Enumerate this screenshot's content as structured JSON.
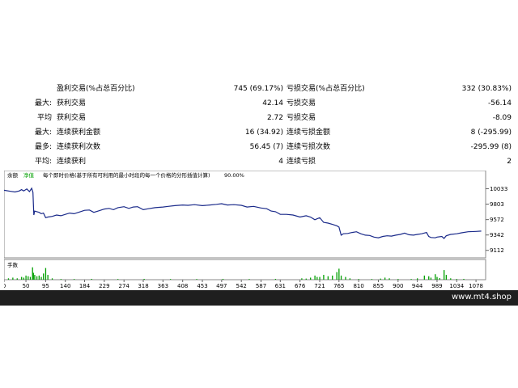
{
  "stats": [
    {
      "prefix": "",
      "label1": "盈利交易(%占总百分比)",
      "value1": "745 (69.17%)",
      "label2": "亏损交易(%占总百分比)",
      "value2": "332 (30.83%)"
    },
    {
      "prefix": "最大:",
      "label1": "获利交易",
      "value1": "42.14",
      "label2": "亏损交易",
      "value2": "-56.14"
    },
    {
      "prefix": "平均",
      "label1": "获利交易",
      "value1": "2.72",
      "label2": "亏损交易",
      "value2": "-8.09"
    },
    {
      "prefix": "最大:",
      "label1": "连续获利金额",
      "value1": "16 (34.92)",
      "label2": "连续亏损金额",
      "value2": "8 (-295.99)"
    },
    {
      "prefix": "最多:",
      "label1": "连续获利次数",
      "value1": "56.45 (7)",
      "label2": "连续亏损次数",
      "value2": "-295.99 (8)"
    },
    {
      "prefix": "平均:",
      "label1": "连续获利",
      "value1": "4",
      "label2": "连续亏损",
      "value2": "2"
    }
  ],
  "chart_header": {
    "tab_balance": "余额",
    "tab_equity": "净值",
    "description": "每个即时价格(基于所有可利用的最小时段的每一个价格的分形插值计算)",
    "quality": "90.00%"
  },
  "chart_data": {
    "type": "line",
    "ylim": [
      9000,
      10160
    ],
    "xlim": [
      0,
      1100
    ],
    "yticks": [
      10033,
      9803,
      9572,
      9342,
      9112
    ],
    "xticks": [
      0,
      50,
      95,
      140,
      184,
      229,
      274,
      318,
      363,
      408,
      453,
      497,
      542,
      587,
      631,
      676,
      721,
      765,
      810,
      855,
      900,
      944,
      989,
      1034,
      1078
    ],
    "series": [
      {
        "line_color": "#1a2a8a",
        "points": [
          [
            0,
            10010
          ],
          [
            15,
            9995
          ],
          [
            25,
            9985
          ],
          [
            35,
            10000
          ],
          [
            40,
            10020
          ],
          [
            45,
            10000
          ],
          [
            52,
            10030
          ],
          [
            58,
            9990
          ],
          [
            63,
            10040
          ],
          [
            66,
            9980
          ],
          [
            68,
            9640
          ],
          [
            70,
            9700
          ],
          [
            75,
            9690
          ],
          [
            80,
            9680
          ],
          [
            85,
            9660
          ],
          [
            90,
            9670
          ],
          [
            95,
            9600
          ],
          [
            100,
            9610
          ],
          [
            110,
            9620
          ],
          [
            120,
            9640
          ],
          [
            130,
            9630
          ],
          [
            140,
            9650
          ],
          [
            150,
            9670
          ],
          [
            160,
            9660
          ],
          [
            170,
            9680
          ],
          [
            184,
            9710
          ],
          [
            195,
            9715
          ],
          [
            205,
            9680
          ],
          [
            215,
            9700
          ],
          [
            229,
            9730
          ],
          [
            240,
            9740
          ],
          [
            250,
            9720
          ],
          [
            260,
            9750
          ],
          [
            274,
            9765
          ],
          [
            285,
            9740
          ],
          [
            295,
            9760
          ],
          [
            305,
            9765
          ],
          [
            318,
            9720
          ],
          [
            330,
            9735
          ],
          [
            345,
            9750
          ],
          [
            363,
            9760
          ],
          [
            375,
            9770
          ],
          [
            390,
            9780
          ],
          [
            408,
            9790
          ],
          [
            420,
            9785
          ],
          [
            435,
            9795
          ],
          [
            453,
            9780
          ],
          [
            470,
            9790
          ],
          [
            485,
            9800
          ],
          [
            497,
            9810
          ],
          [
            510,
            9790
          ],
          [
            525,
            9795
          ],
          [
            542,
            9785
          ],
          [
            555,
            9760
          ],
          [
            570,
            9770
          ],
          [
            587,
            9745
          ],
          [
            600,
            9735
          ],
          [
            610,
            9700
          ],
          [
            620,
            9690
          ],
          [
            631,
            9650
          ],
          [
            645,
            9650
          ],
          [
            660,
            9640
          ],
          [
            676,
            9610
          ],
          [
            690,
            9630
          ],
          [
            700,
            9610
          ],
          [
            710,
            9570
          ],
          [
            721,
            9600
          ],
          [
            730,
            9530
          ],
          [
            740,
            9520
          ],
          [
            750,
            9500
          ],
          [
            760,
            9480
          ],
          [
            765,
            9460
          ],
          [
            770,
            9340
          ],
          [
            775,
            9360
          ],
          [
            785,
            9365
          ],
          [
            795,
            9380
          ],
          [
            805,
            9390
          ],
          [
            815,
            9360
          ],
          [
            825,
            9340
          ],
          [
            835,
            9335
          ],
          [
            845,
            9310
          ],
          [
            855,
            9300
          ],
          [
            865,
            9320
          ],
          [
            875,
            9330
          ],
          [
            885,
            9325
          ],
          [
            895,
            9340
          ],
          [
            905,
            9350
          ],
          [
            915,
            9370
          ],
          [
            925,
            9345
          ],
          [
            935,
            9340
          ],
          [
            944,
            9350
          ],
          [
            954,
            9360
          ],
          [
            965,
            9380
          ],
          [
            970,
            9320
          ],
          [
            975,
            9305
          ],
          [
            985,
            9300
          ],
          [
            989,
            9310
          ],
          [
            1000,
            9320
          ],
          [
            1005,
            9290
          ],
          [
            1010,
            9330
          ],
          [
            1020,
            9350
          ],
          [
            1034,
            9360
          ],
          [
            1045,
            9375
          ],
          [
            1060,
            9390
          ],
          [
            1078,
            9395
          ],
          [
            1090,
            9400
          ]
        ]
      }
    ],
    "volume": {
      "label": "手数",
      "bar_color": "#00a000",
      "bars": [
        [
          10,
          0.1
        ],
        [
          20,
          0.15
        ],
        [
          30,
          0.1
        ],
        [
          40,
          0.2
        ],
        [
          45,
          0.15
        ],
        [
          50,
          0.3
        ],
        [
          55,
          0.25
        ],
        [
          60,
          0.2
        ],
        [
          65,
          0.9
        ],
        [
          67,
          0.5
        ],
        [
          70,
          0.35
        ],
        [
          75,
          0.25
        ],
        [
          80,
          0.3
        ],
        [
          85,
          0.2
        ],
        [
          90,
          0.45
        ],
        [
          95,
          0.85
        ],
        [
          100,
          0.35
        ],
        [
          110,
          0.1
        ],
        [
          130,
          0.05
        ],
        [
          160,
          0.05
        ],
        [
          200,
          0.06
        ],
        [
          260,
          0.05
        ],
        [
          320,
          0.06
        ],
        [
          380,
          0.05
        ],
        [
          440,
          0.05
        ],
        [
          500,
          0.06
        ],
        [
          560,
          0.05
        ],
        [
          620,
          0.06
        ],
        [
          680,
          0.1
        ],
        [
          690,
          0.08
        ],
        [
          700,
          0.15
        ],
        [
          710,
          0.3
        ],
        [
          715,
          0.2
        ],
        [
          721,
          0.2
        ],
        [
          730,
          0.35
        ],
        [
          740,
          0.25
        ],
        [
          750,
          0.3
        ],
        [
          760,
          0.55
        ],
        [
          765,
          0.8
        ],
        [
          770,
          0.3
        ],
        [
          780,
          0.2
        ],
        [
          790,
          0.1
        ],
        [
          810,
          0.05
        ],
        [
          840,
          0.05
        ],
        [
          860,
          0.08
        ],
        [
          870,
          0.15
        ],
        [
          880,
          0.1
        ],
        [
          900,
          0.05
        ],
        [
          930,
          0.05
        ],
        [
          944,
          0.1
        ],
        [
          960,
          0.3
        ],
        [
          970,
          0.25
        ],
        [
          975,
          0.15
        ],
        [
          985,
          0.4
        ],
        [
          989,
          0.2
        ],
        [
          995,
          0.12
        ],
        [
          1005,
          0.7
        ],
        [
          1010,
          0.35
        ],
        [
          1020,
          0.1
        ],
        [
          1034,
          0.05
        ],
        [
          1050,
          0.06
        ]
      ]
    }
  }
}
